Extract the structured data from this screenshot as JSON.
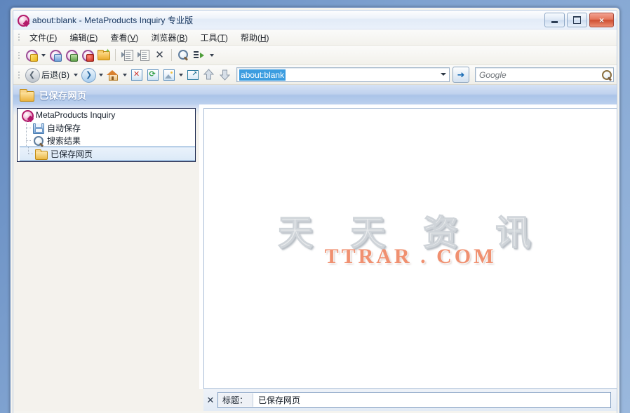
{
  "window": {
    "title": "about:blank - MetaProducts Inquiry 专业版",
    "app_icon": "q-logo-icon",
    "controls": {
      "minimize": "minimize-button",
      "maximize": "maximize-button",
      "close": "×"
    }
  },
  "menubar": {
    "items": [
      {
        "label": "文件",
        "mnemonic": "F"
      },
      {
        "label": "编辑",
        "mnemonic": "E"
      },
      {
        "label": "查看",
        "mnemonic": "V"
      },
      {
        "label": "浏览器",
        "mnemonic": "B"
      },
      {
        "label": "工具",
        "mnemonic": "T"
      },
      {
        "label": "帮助",
        "mnemonic": "H"
      }
    ]
  },
  "toolbar": {
    "buttons": [
      {
        "name": "download-page-button",
        "icon": "q-yellow-icon",
        "has_dropdown": true
      },
      {
        "name": "save-page-button",
        "icon": "q-floppy-icon",
        "has_dropdown": false
      },
      {
        "name": "save-image-button",
        "icon": "q-image-icon",
        "has_dropdown": false
      },
      {
        "name": "record-button",
        "icon": "q-record-icon",
        "has_dropdown": false
      },
      {
        "name": "new-folder-button",
        "icon": "new-folder-icon",
        "has_dropdown": false
      },
      {
        "name": "import-button",
        "icon": "doc-in-icon",
        "has_dropdown": false
      },
      {
        "name": "export-button",
        "icon": "doc-out-icon",
        "has_dropdown": false
      },
      {
        "name": "delete-button",
        "icon": "delete-x-icon",
        "has_dropdown": false
      },
      {
        "name": "find-button",
        "icon": "magnifier-icon",
        "has_dropdown": false
      },
      {
        "name": "properties-button",
        "icon": "list-arrow-icon",
        "has_dropdown": true
      }
    ]
  },
  "addressbar": {
    "back_label": "后退",
    "back_mnemonic": "B",
    "forward_name": "forward-button",
    "home_name": "home-button",
    "stop_name": "stop-button",
    "refresh_name": "refresh-button",
    "images_name": "show-images-button",
    "open_external_name": "open-external-button",
    "up_name": "scroll-up-button",
    "down_name": "scroll-down-button",
    "url_value": "about:blank",
    "go_glyph": "➜",
    "search_placeholder": "Google"
  },
  "band": {
    "icon": "folder-icon",
    "title": "已保存网页"
  },
  "tree": {
    "nodes": [
      {
        "label": "MetaProducts Inquiry",
        "icon": "q-logo-icon",
        "level": 0,
        "selected": false
      },
      {
        "label": "自动保存",
        "icon": "floppy-icon",
        "level": 1,
        "selected": false
      },
      {
        "label": "搜索结果",
        "icon": "magnifier-icon",
        "level": 1,
        "selected": false
      },
      {
        "label": "已保存网页",
        "icon": "folder-icon",
        "level": 1,
        "selected": true
      }
    ]
  },
  "content": {
    "watermark_cn": "天 天 资 讯",
    "watermark_en": "TTRAR . COM"
  },
  "bottomdock": {
    "close_glyph": "✕",
    "field_label": "标题：",
    "field_value": "已保存网页"
  },
  "colors": {
    "accent_blue": "#3c9de0",
    "band_blue": "#aac4e8",
    "desktop_blue": "#7fa2d0",
    "watermark_orange": "#f09070",
    "close_red": "#cf4f32"
  }
}
